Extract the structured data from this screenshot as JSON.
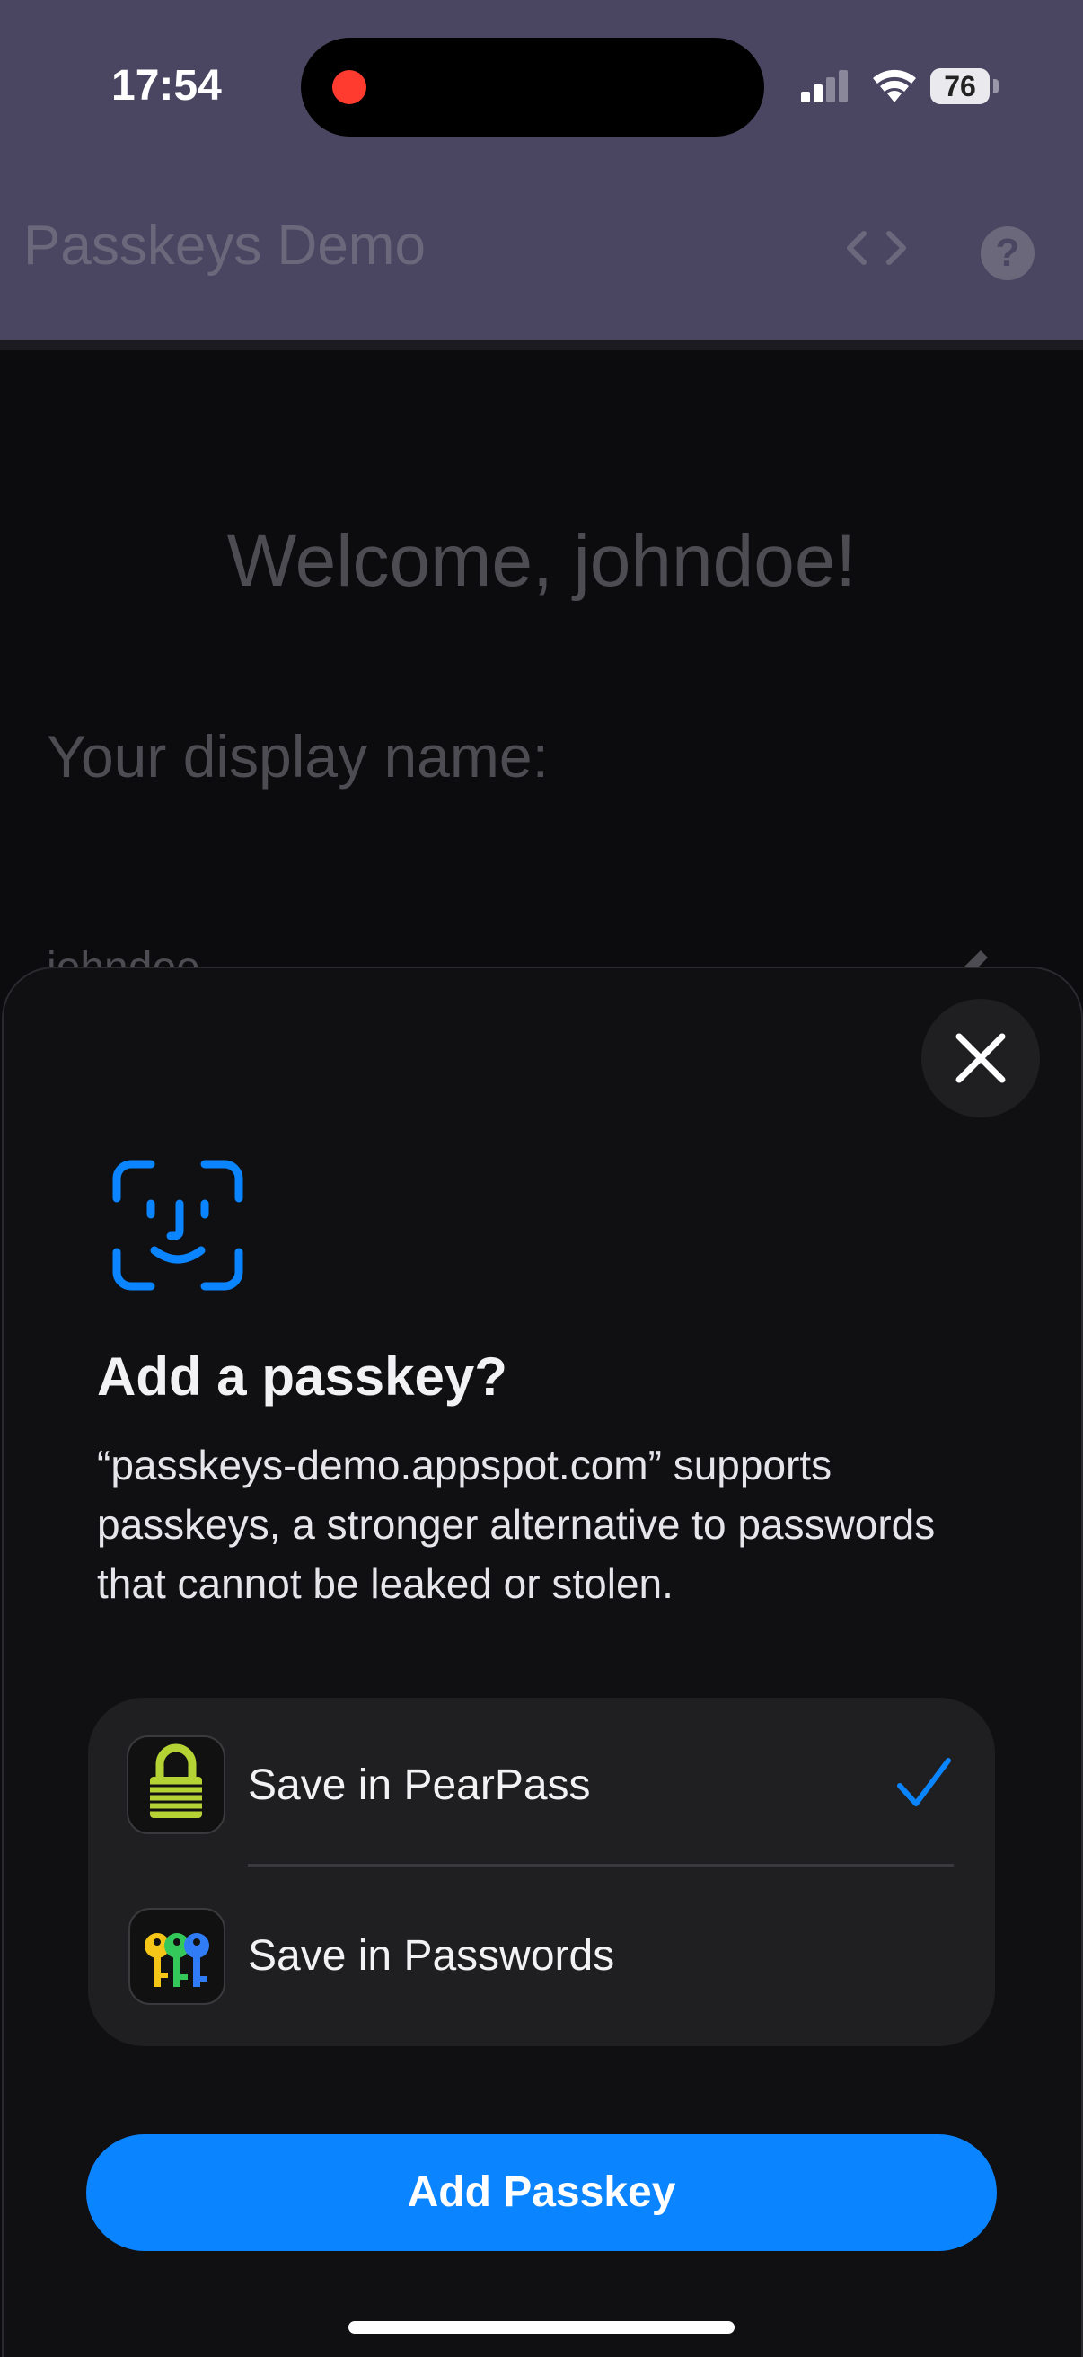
{
  "status_bar": {
    "time": "17:54",
    "battery": "76"
  },
  "app_bar": {
    "title": "Passkeys Demo",
    "code_icon": "code-brackets-icon",
    "help_icon": "help-circle-icon",
    "help_glyph": "?"
  },
  "page": {
    "welcome": "Welcome, johndoe!",
    "display_name_label": "Your display name:",
    "display_name_value": "johndoe"
  },
  "sheet": {
    "title": "Add a passkey?",
    "description": "“passkeys-demo.appspot.com” supports passkeys, a stronger alternative to passwords that cannot be leaked or stolen.",
    "options": [
      {
        "label": "Save in PearPass",
        "icon": "pearpass-lock-icon",
        "selected": true
      },
      {
        "label": "Save in Passwords",
        "icon": "passwords-keys-icon",
        "selected": false
      }
    ],
    "primary_button": "Add Passkey"
  },
  "colors": {
    "accent": "#0a84ff",
    "app_bar": "#4a4560",
    "sheet_bg": "#101012",
    "record_dot": "#ff3b30",
    "pearpass_green": "#b5d335"
  }
}
